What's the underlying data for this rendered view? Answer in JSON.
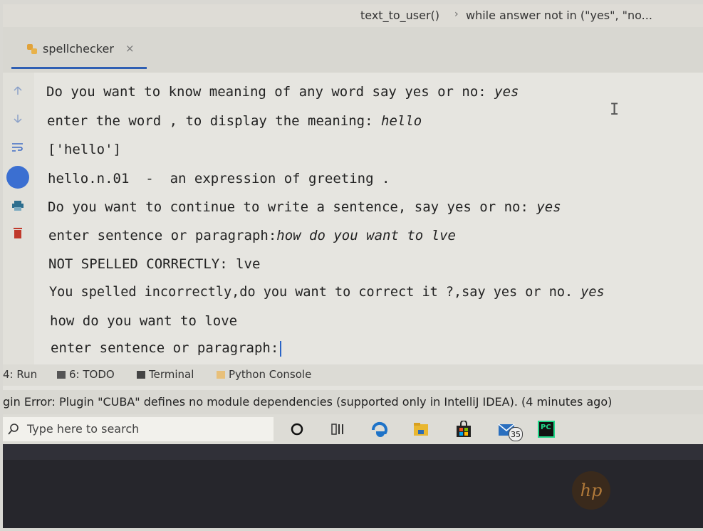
{
  "breadcrumb": {
    "function": "text_to_user()",
    "separator": "›",
    "statement": "while answer not in (\"yes\", \"no..."
  },
  "tab": {
    "label": "spellchecker",
    "close": "×"
  },
  "console": {
    "lines": [
      {
        "text": "Do you want to know meaning of any word say yes or no: ",
        "input": "yes"
      },
      {
        "text": "enter the word , to display the meaning: ",
        "input": "hello"
      },
      {
        "text": "['hello']",
        "input": ""
      },
      {
        "text": "hello.n.01  -  an expression of greeting .",
        "input": ""
      },
      {
        "text": "Do you want to continue to write a sentence, say yes or no: ",
        "input": "yes"
      },
      {
        "text": "enter sentence or paragraph:",
        "input": "how do you want to lve"
      },
      {
        "text": "NOT SPELLED CORRECTLY: lve",
        "input": ""
      },
      {
        "text": "You spelled incorrectly,do you want to correct it ?,say yes or no. ",
        "input": "yes"
      },
      {
        "text": "how do you want to love",
        "input": ""
      },
      {
        "text": "enter sentence or paragraph:",
        "input": ""
      }
    ]
  },
  "tool_windows": {
    "run": "4: Run",
    "todo": "6: TODO",
    "terminal": "Terminal",
    "python_console": "Python Console"
  },
  "status": {
    "message": "gin Error: Plugin \"CUBA\" defines no module dependencies (supported only in IntelliJ IDEA). (4 minutes ago)"
  },
  "taskbar": {
    "search_placeholder": "Type here to search",
    "mail_badge": "35",
    "pycharm_label": "PC"
  },
  "bezel": {
    "logo": "hp"
  },
  "colors": {
    "accent": "#2f5fb3",
    "caret": "#2a64c6",
    "stop_icon": "#c0392b",
    "edge_blue": "#1e73c8"
  }
}
